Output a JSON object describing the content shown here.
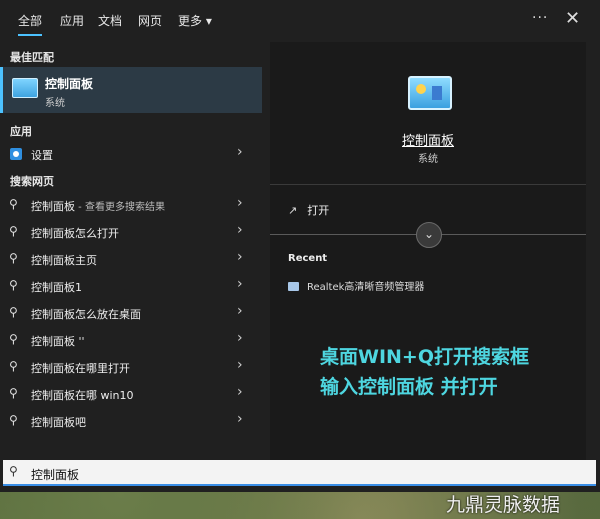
{
  "tabs": [
    {
      "label": "全部"
    },
    {
      "label": "应用"
    },
    {
      "label": "文档"
    },
    {
      "label": "网页"
    },
    {
      "label": "更多 ▾"
    }
  ],
  "window_controls": {
    "more": "···",
    "close": "✕"
  },
  "sections": {
    "best_match": "最佳匹配",
    "apps": "应用",
    "web": "搜索网页"
  },
  "best_match": {
    "title": "控制面板",
    "subtitle": "系统"
  },
  "apps": [
    {
      "label": "设置"
    }
  ],
  "web_results": [
    {
      "label": "控制面板",
      "suffix": " - 查看更多搜索结果"
    },
    {
      "label": "控制面板怎么打开",
      "suffix": ""
    },
    {
      "label": "控制面板主页",
      "suffix": ""
    },
    {
      "label": "控制面板1",
      "suffix": ""
    },
    {
      "label": "控制面板怎么放在桌面",
      "suffix": ""
    },
    {
      "label": "控制面板 ''",
      "suffix": ""
    },
    {
      "label": "控制面板在哪里打开",
      "suffix": ""
    },
    {
      "label": "控制面板在哪 win10",
      "suffix": ""
    },
    {
      "label": "控制面板吧",
      "suffix": ""
    }
  ],
  "detail": {
    "title": "控制面板",
    "subtitle": "系统",
    "open_label": "打开",
    "recent_heading": "Recent",
    "recent_items": [
      {
        "label": "Realtek高清晰音频管理器"
      }
    ]
  },
  "overlay_text": [
    "桌面WIN+Q打开搜索框",
    "输入控制面板 并打开"
  ],
  "search": {
    "value": "控制面板"
  },
  "watermark": "九鼎灵脉数据",
  "colors": {
    "accent": "#4cc2ff",
    "overlay": "#4ed6e0",
    "panel": "#202020"
  }
}
